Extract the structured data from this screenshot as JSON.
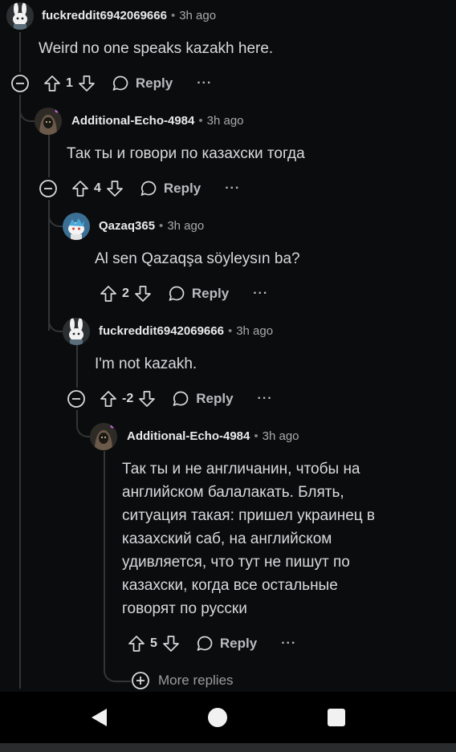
{
  "comments": [
    {
      "user": "fuckreddit6942069666",
      "time": "3h ago",
      "body": "Weird no one speaks kazakh here.",
      "votes": "1",
      "reply_label": "Reply",
      "more_label": "···"
    },
    {
      "user": "Additional-Echo-4984",
      "time": "3h ago",
      "body": "Так ты и говори по казахски тогда",
      "votes": "4",
      "reply_label": "Reply",
      "more_label": "···"
    },
    {
      "user": "Qazaq365",
      "time": "3h ago",
      "body": "Al sen Qazaqşa söyleysın ba?",
      "votes": "2",
      "reply_label": "Reply",
      "more_label": "···"
    },
    {
      "user": "fuckreddit6942069666",
      "time": "3h ago",
      "body": "I'm not kazakh.",
      "votes": "-2",
      "reply_label": "Reply",
      "more_label": "···"
    },
    {
      "user": "Additional-Echo-4984",
      "time": "3h ago",
      "body_lines": [
        "Так ты и не англичанин, чтобы на",
        "английском балалакать. Блять,",
        "ситуация такая: пришел украинец в",
        "казахский саб, на английском",
        "удивляется, что тут не пишут по",
        "казахски, когда все остальные",
        "говорят по русски"
      ],
      "votes": "5",
      "reply_label": "Reply",
      "more_label": "···"
    }
  ],
  "separator": "•",
  "more_replies_label": "More replies",
  "colors": {
    "background": "#0b0c0d",
    "thread_line": "#343536",
    "text": "#d7dadc"
  },
  "icons": [
    "bunny-avatar-icon",
    "hooded-avatar-icon",
    "snoo-avatar-icon",
    "collapse-icon",
    "upvote-icon",
    "downvote-icon",
    "reply-bubble-icon",
    "more-icon",
    "plus-circle-icon",
    "nav-back-icon",
    "nav-home-icon",
    "nav-recents-icon"
  ]
}
